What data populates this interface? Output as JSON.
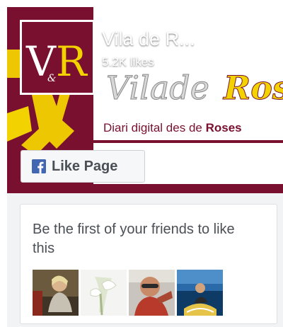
{
  "page": {
    "name": "Vila de R...",
    "likes": "5.2K likes",
    "cover_tagline": "Diari digital des de ",
    "cover_tagline_bold": "Roses",
    "logo_text": "VilasdeRoses"
  },
  "like_button": {
    "label": "Like Page",
    "icon": "facebook-f-icon"
  },
  "friends": {
    "text": "Be the first of your friends to like this",
    "count": 4
  },
  "colors": {
    "brand_maroon": "#7a1030",
    "logo_yellow": "#f2d200",
    "facebook_blue": "#4267b2",
    "text_gray": "#4b4f56",
    "panel_bg": "#f2f3f5"
  }
}
